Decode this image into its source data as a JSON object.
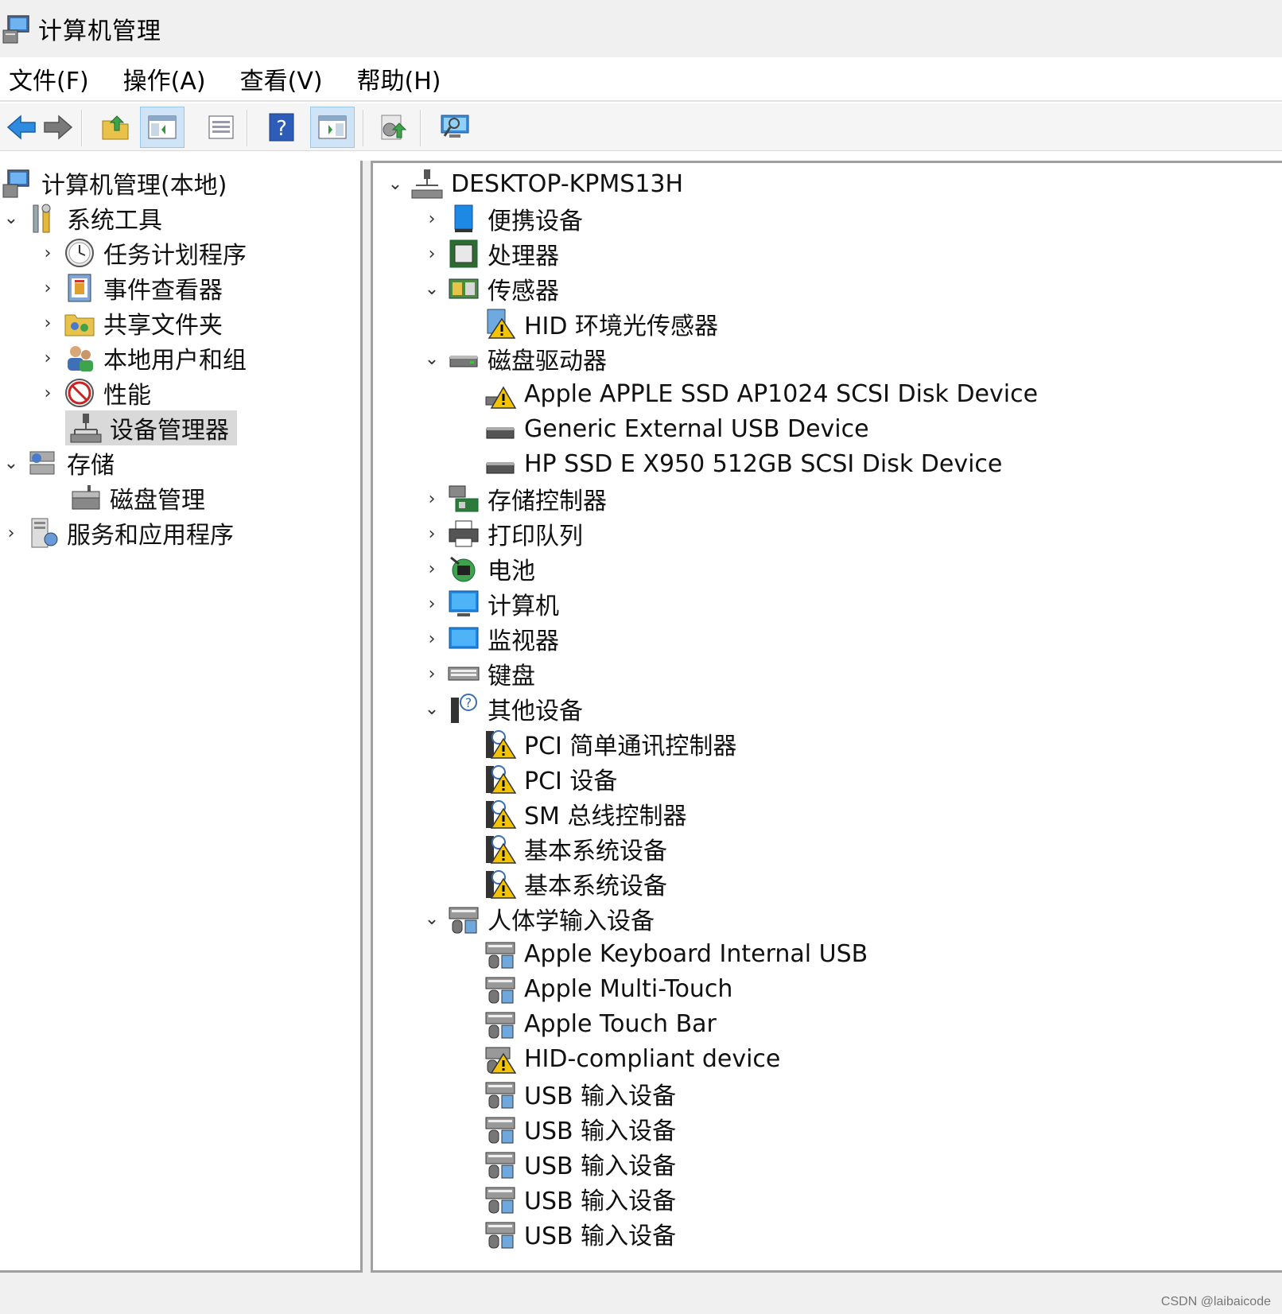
{
  "window": {
    "title": "计算机管理"
  },
  "menu": [
    {
      "label": "文件(F)"
    },
    {
      "label": "操作(A)"
    },
    {
      "label": "查看(V)"
    },
    {
      "label": "帮助(H)"
    }
  ],
  "left_tree": {
    "root": "计算机管理(本地)",
    "system_tools": "系统工具",
    "task_scheduler": "任务计划程序",
    "event_viewer": "事件查看器",
    "shared_folders": "共享文件夹",
    "local_users": "本地用户和组",
    "performance": "性能",
    "device_manager": "设备管理器",
    "storage": "存储",
    "disk_management": "磁盘管理",
    "services": "服务和应用程序"
  },
  "device_tree": {
    "computer_name": "DESKTOP-KPMS13H",
    "portable": "便携设备",
    "processors": "处理器",
    "sensors": "传感器",
    "hid_light_sensor": "HID 环境光传感器",
    "disk_drives": "磁盘驱动器",
    "disk1": "Apple APPLE SSD AP1024 SCSI Disk Device",
    "disk2": "Generic External USB Device",
    "disk3": "HP SSD E X950 512GB SCSI Disk Device",
    "storage_controllers": "存储控制器",
    "print_queues": "打印队列",
    "batteries": "电池",
    "computer": "计算机",
    "monitors": "监视器",
    "keyboards": "键盘",
    "other_devices": "其他设备",
    "pci_simple_comm": "PCI 简单通讯控制器",
    "pci_device": "PCI 设备",
    "sm_bus": "SM 总线控制器",
    "base_system_1": "基本系统设备",
    "base_system_2": "基本系统设备",
    "hid": "人体学输入设备",
    "apple_keyboard": "Apple Keyboard Internal USB",
    "apple_multitouch": "Apple Multi-Touch",
    "apple_touchbar": "Apple Touch Bar",
    "hid_compliant": "HID-compliant device",
    "usb_input_1": "USB 输入设备",
    "usb_input_2": "USB 输入设备",
    "usb_input_3": "USB 输入设备",
    "usb_input_4": "USB 输入设备",
    "usb_input_5": "USB 输入设备"
  },
  "watermark": "CSDN @laibaicode",
  "colors": {
    "accent_blue": "#1e88e5",
    "warning_yellow": "#f5c400",
    "selection": "#d9d9d9"
  }
}
